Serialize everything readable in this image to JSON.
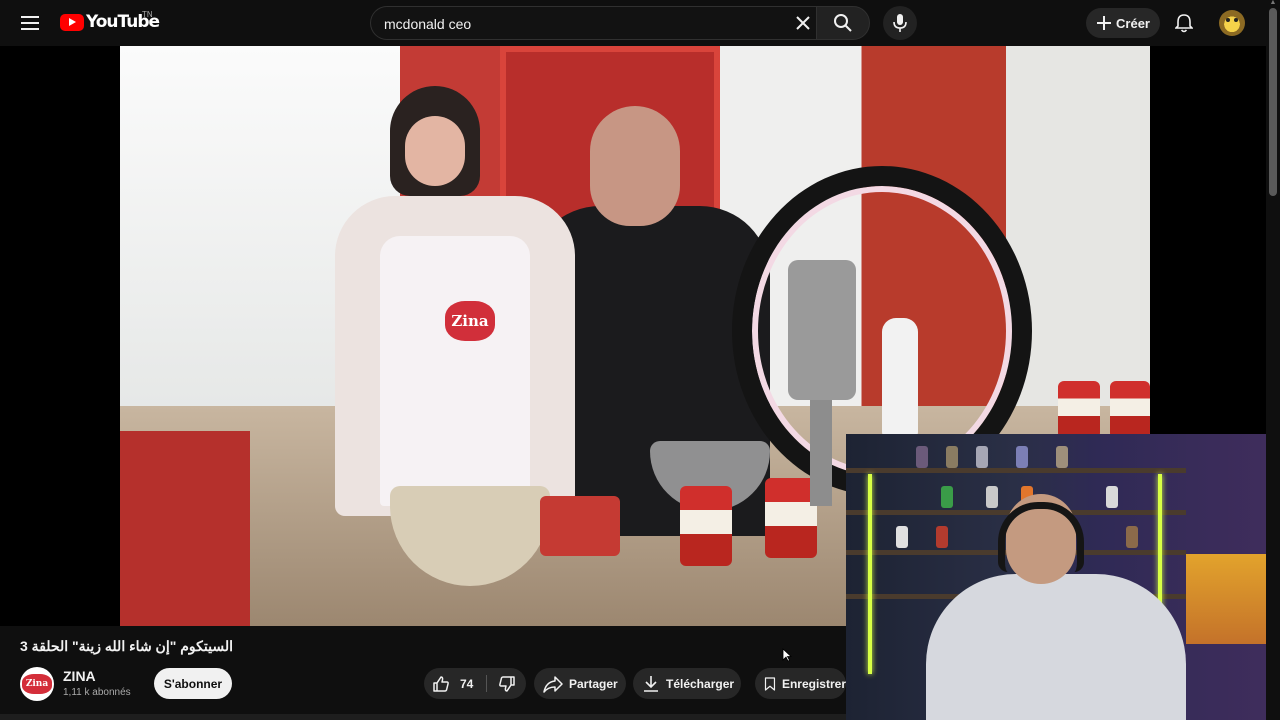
{
  "header": {
    "logo_text": "YouTube",
    "region_code": "TN",
    "search": {
      "value": "mcdonald ceo",
      "placeholder": "Rechercher"
    },
    "create_label": "Créer"
  },
  "video": {
    "title": "السيتكوم \"إن شاء الله زينة\" الحلقة 3",
    "apron_logo": "Zina"
  },
  "channel": {
    "name": "ZINA",
    "avatar_text": "Zina",
    "subscribers": "1,11 k abonnés",
    "subscribe_label": "S'abonner"
  },
  "actions": {
    "like_count": "74",
    "share_label": "Partager",
    "download_label": "Télécharger",
    "save_label": "Enregistrer"
  },
  "colors": {
    "background": "#0f0f0f",
    "brand_red": "#ff0000",
    "button_bg": "#272727",
    "subscribe_bg": "#f1f1f1"
  },
  "icons": [
    "menu-icon",
    "youtube-logo-icon",
    "close-icon",
    "search-icon",
    "mic-icon",
    "plus-icon",
    "bell-icon",
    "thumbs-up-icon",
    "thumbs-down-icon",
    "share-icon",
    "download-icon",
    "bookmark-icon"
  ]
}
